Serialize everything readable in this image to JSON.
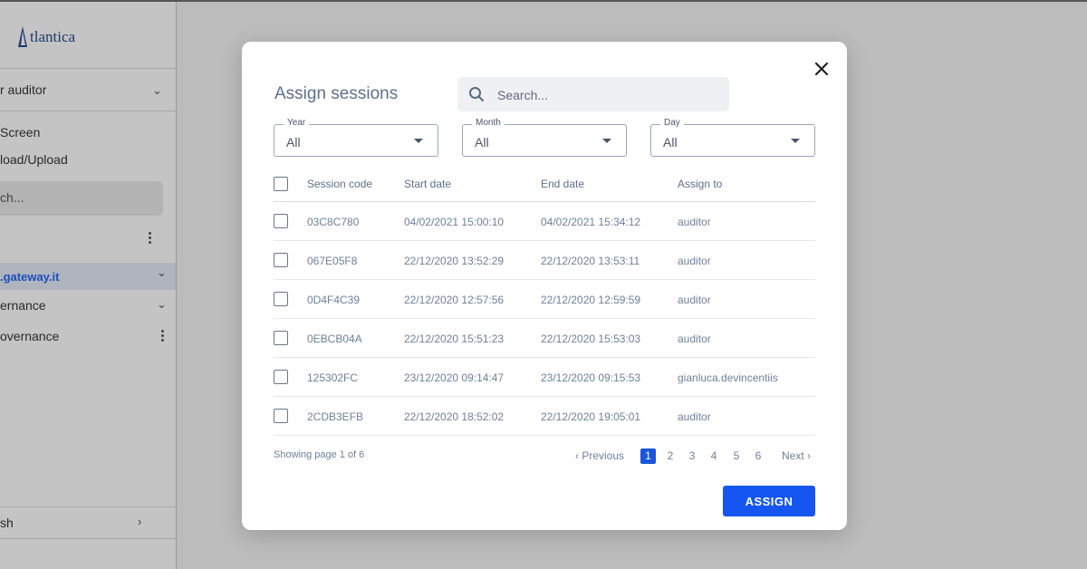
{
  "sidebar": {
    "brand": "tlantica",
    "user_menu": "r auditor",
    "links": [
      "Screen",
      "load/Upload"
    ],
    "search_placeholder": "ch...",
    "tree": [
      {
        "label": ".gateway.it",
        "active": true
      },
      {
        "label": "ernance"
      },
      {
        "label": "overnance"
      }
    ],
    "footer": "sh"
  },
  "modal": {
    "title": "Assign sessions",
    "search_placeholder": "Search...",
    "filters": [
      {
        "label": "Year",
        "value": "All"
      },
      {
        "label": "Month",
        "value": "All"
      },
      {
        "label": "Day",
        "value": "All"
      }
    ],
    "columns": [
      "Session code",
      "Start date",
      "End date",
      "Assign to"
    ],
    "rows": [
      {
        "code": "03C8C780",
        "start": "04/02/2021 15:00:10",
        "end": "04/02/2021 15:34:12",
        "assign": "auditor"
      },
      {
        "code": "067E05F8",
        "start": "22/12/2020 13:52:29",
        "end": "22/12/2020 13:53:11",
        "assign": "auditor"
      },
      {
        "code": "0D4F4C39",
        "start": "22/12/2020 12:57:56",
        "end": "22/12/2020 12:59:59",
        "assign": "auditor"
      },
      {
        "code": "0EBCB04A",
        "start": "22/12/2020 15:51:23",
        "end": "22/12/2020 15:53:03",
        "assign": "auditor"
      },
      {
        "code": "125302FC",
        "start": "23/12/2020 09:14:47",
        "end": "23/12/2020 09:15:53",
        "assign": "gianluca.devincentiis"
      },
      {
        "code": "2CDB3EFB",
        "start": "22/12/2020 18:52:02",
        "end": "22/12/2020 19:05:01",
        "assign": "auditor"
      }
    ],
    "showing": "Showing page 1 of 6",
    "pagination": {
      "previous": "Previous",
      "next": "Next",
      "pages": [
        "1",
        "2",
        "3",
        "4",
        "5",
        "6"
      ],
      "current": "1"
    },
    "assign_label": "ASSIGN"
  },
  "colors": {
    "accent": "#1656f0",
    "title": "#5e6f8d",
    "text": "#6f7f9a"
  }
}
